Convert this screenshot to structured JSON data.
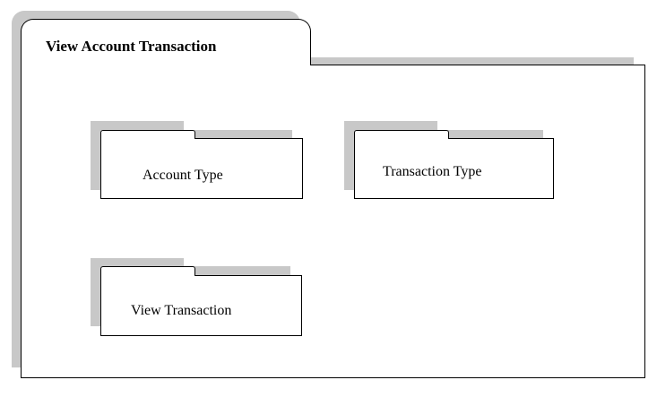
{
  "package": {
    "title": "View Account Transaction"
  },
  "subpackages": [
    {
      "label": "Account Type"
    },
    {
      "label": "Transaction Type"
    },
    {
      "label": "View Transaction"
    }
  ]
}
